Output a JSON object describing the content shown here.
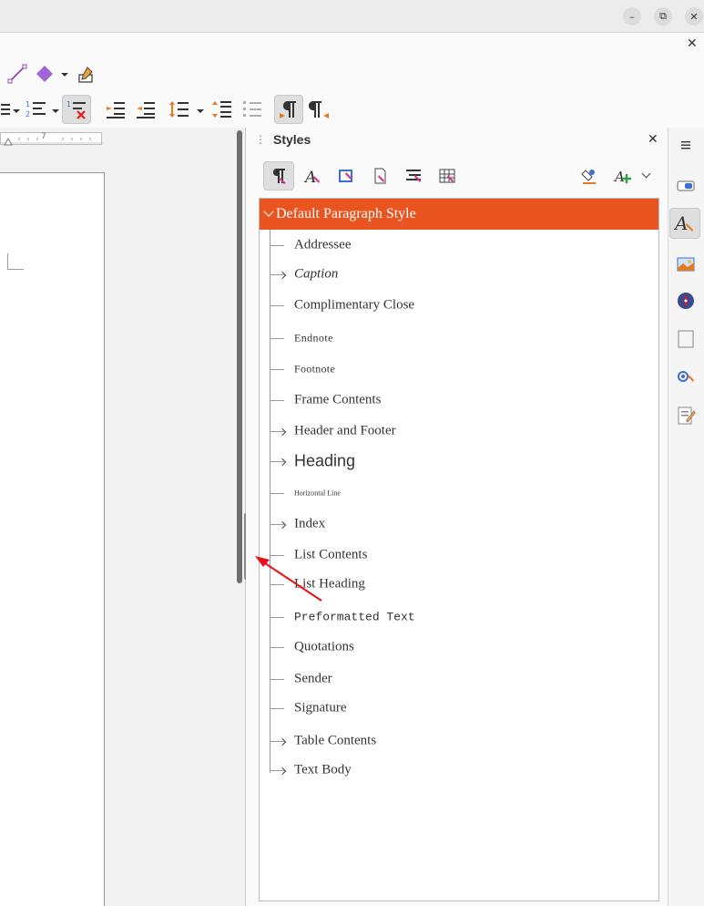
{
  "window": {
    "minimize_glyph": "–",
    "restore_glyph": "⧉",
    "close_glyph": "✕",
    "doc_close_glyph": "✕"
  },
  "ruler": {
    "mark": "7"
  },
  "styles_deck": {
    "title": "Styles",
    "close_glyph": "✕",
    "selected_style": "Default Paragraph Style",
    "styles": [
      {
        "label": "Addressee",
        "expandable": false
      },
      {
        "label": "Caption",
        "expandable": true
      },
      {
        "label": "Complimentary Close",
        "expandable": false
      },
      {
        "label": "Endnote",
        "expandable": false
      },
      {
        "label": "Footnote",
        "expandable": false
      },
      {
        "label": "Frame Contents",
        "expandable": false
      },
      {
        "label": "Header and Footer",
        "expandable": true
      },
      {
        "label": "Heading",
        "expandable": true
      },
      {
        "label": "Horizontal Line",
        "expandable": false
      },
      {
        "label": "Index",
        "expandable": true
      },
      {
        "label": "List Contents",
        "expandable": false
      },
      {
        "label": "List Heading",
        "expandable": false
      },
      {
        "label": "Preformatted Text",
        "expandable": false
      },
      {
        "label": "Quotations",
        "expandable": false
      },
      {
        "label": "Sender",
        "expandable": false
      },
      {
        "label": "Signature",
        "expandable": false
      },
      {
        "label": "Table Contents",
        "expandable": true
      },
      {
        "label": "Text Body",
        "expandable": true
      }
    ]
  },
  "colors": {
    "accent": "#e95420",
    "annotation_arrow": "#e8101a"
  }
}
